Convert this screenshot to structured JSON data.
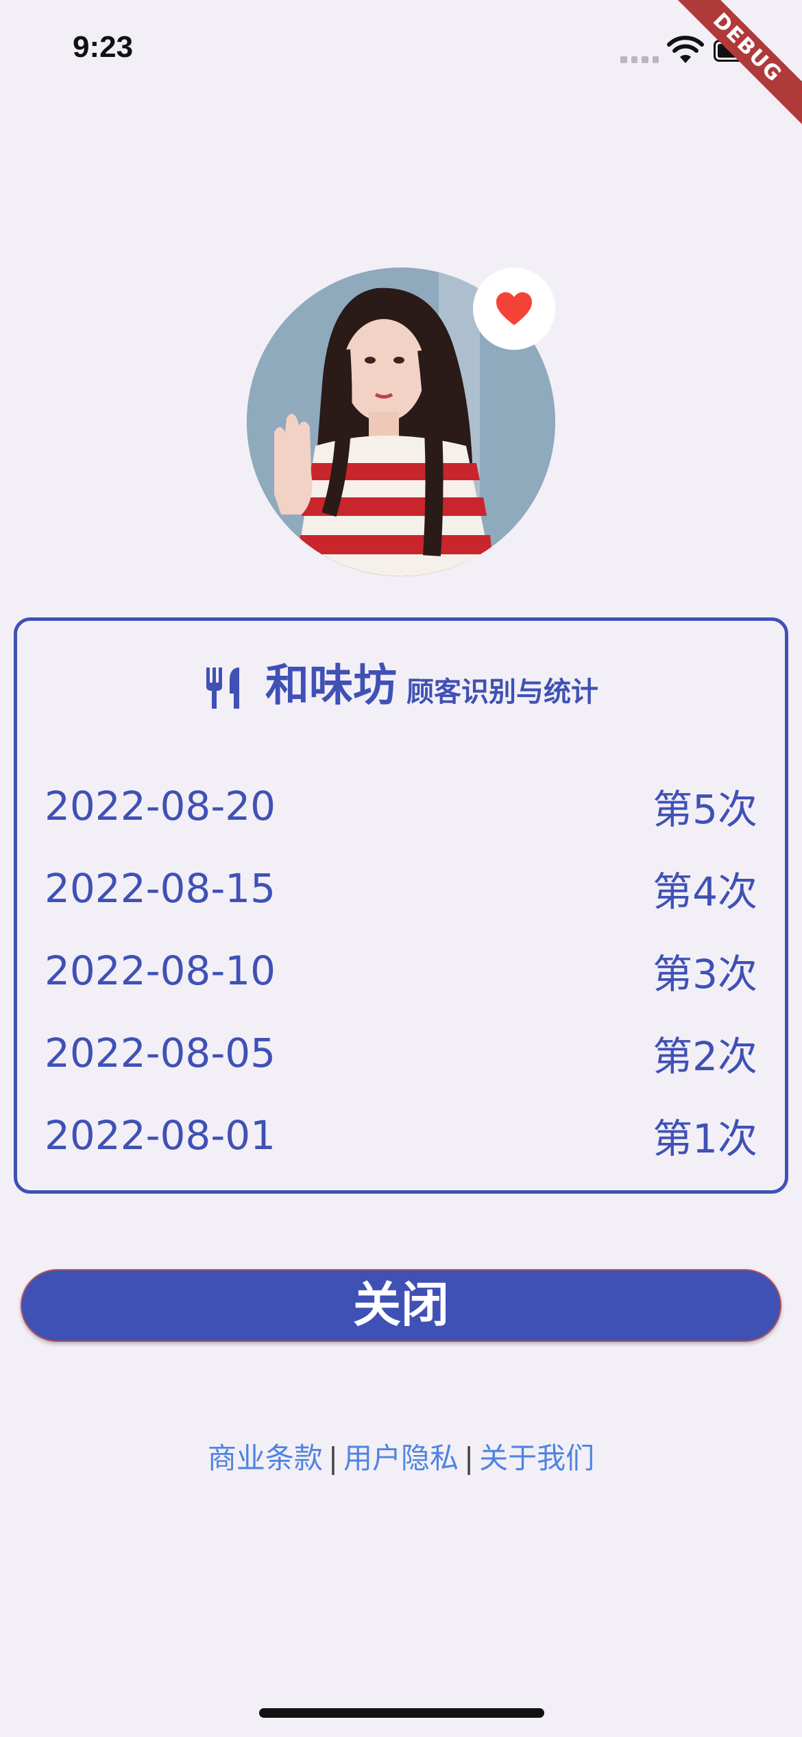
{
  "status_bar": {
    "time": "9:23"
  },
  "debug_ribbon": {
    "label": "DEBUG"
  },
  "card": {
    "brand": "和味坊",
    "subtitle": "顾客识别与统计",
    "visits": [
      {
        "date": "2022-08-20",
        "count": "第5次"
      },
      {
        "date": "2022-08-15",
        "count": "第4次"
      },
      {
        "date": "2022-08-10",
        "count": "第3次"
      },
      {
        "date": "2022-08-05",
        "count": "第2次"
      },
      {
        "date": "2022-08-01",
        "count": "第1次"
      }
    ]
  },
  "close_button": {
    "label": "关闭"
  },
  "footer": {
    "terms": "商业条款",
    "privacy": "用户隐私",
    "about": "关于我们",
    "separator": "|"
  },
  "colors": {
    "primary": "#3f51b5",
    "background": "#f3eff6",
    "heart": "#f44336",
    "link": "#4f84e0"
  },
  "icons": {
    "heart": "heart-icon",
    "restaurant": "restaurant-icon"
  }
}
